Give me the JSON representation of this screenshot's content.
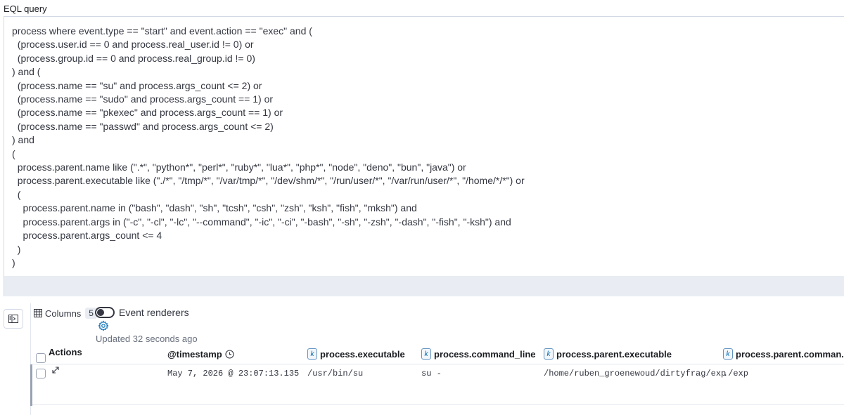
{
  "query": {
    "label": "EQL query",
    "lines": [
      "process where event.type == \"start\" and event.action == \"exec\" and (",
      "  (process.user.id == 0 and process.real_user.id != 0) or",
      "  (process.group.id == 0 and process.real_group.id != 0)",
      ") and (",
      "  (process.name == \"su\" and process.args_count <= 2) or",
      "  (process.name == \"sudo\" and process.args_count == 1) or",
      "  (process.name == \"pkexec\" and process.args_count == 1) or",
      "  (process.name == \"passwd\" and process.args_count <= 2)",
      ") and",
      "(",
      "  process.parent.name like (\".*\", \"python*\", \"perl*\", \"ruby*\", \"lua*\", \"php*\", \"node\", \"deno\", \"bun\", \"java\") or",
      "  process.parent.executable like (\"./*\", \"/tmp/*\", \"/var/tmp/*\", \"/dev/shm/*\", \"/run/user/*\", \"/var/run/user/*\", \"/home/*/*\") or",
      "  (",
      "    process.parent.name in (\"bash\", \"dash\", \"sh\", \"tcsh\", \"csh\", \"zsh\", \"ksh\", \"fish\", \"mksh\") and",
      "    process.parent.args in (\"-c\", \"-cl\", \"-lc\", \"--command\", \"-ic\", \"-ci\", \"-bash\", \"-sh\", \"-zsh\", \"-dash\", \"-fish\", \"-ksh\") and",
      "    process.parent.args_count <= 4",
      "  )",
      ")"
    ]
  },
  "toolbar": {
    "columns_label": "Columns",
    "columns_count": "5",
    "renderers_label": "Event renderers",
    "updated": "Updated 32 seconds ago"
  },
  "table": {
    "headers": {
      "actions": "Actions",
      "timestamp": "@timestamp",
      "executable": "process.executable",
      "command_line": "process.command_line",
      "parent_executable": "process.parent.executable",
      "parent_command": "process.parent.comman..."
    },
    "field_type_badge": "k",
    "rows": [
      {
        "timestamp": "May 7, 2026 @ 23:07:13.135",
        "executable": "/usr/bin/su",
        "command_line": "su -",
        "parent_executable": "/home/ruben_groenewoud/dirtyfrag/exp",
        "parent_command": "./exp"
      }
    ]
  },
  "colors": {
    "accent": "#006bb8",
    "border": "#d3dae6",
    "footer": "#e9edf3"
  }
}
